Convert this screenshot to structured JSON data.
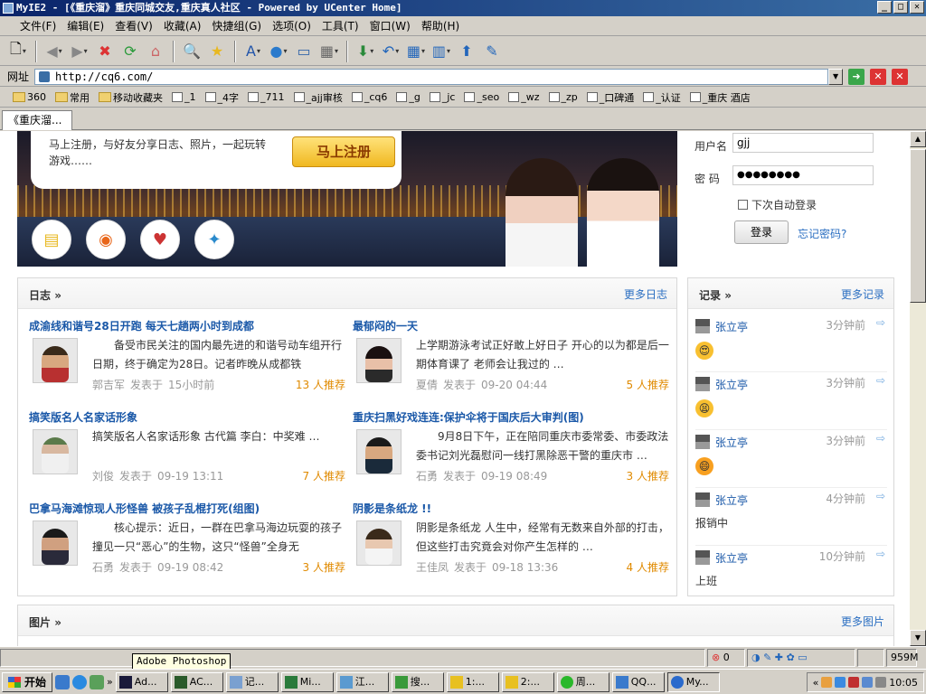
{
  "window": {
    "title": "MyIE2 - [《重庆溜》重庆同城交友,重庆真人社区 - Powered by UCenter Home]",
    "controls": [
      "_",
      "□",
      "✕"
    ]
  },
  "menu": [
    "文件(F)",
    "编辑(E)",
    "查看(V)",
    "收藏(A)",
    "快捷组(G)",
    "选项(O)",
    "工具(T)",
    "窗口(W)",
    "帮助(H)"
  ],
  "address": {
    "label": "网址",
    "value": "http://cq6.com/"
  },
  "favorites": [
    "360",
    "常用",
    "移动收藏夹",
    "_1",
    "_4字",
    "_711",
    "_ajj审核",
    "_cq6",
    "_g",
    "_jc",
    "_seo",
    "_wz",
    "_zp",
    "_口碑通",
    "_认证",
    "_重庆 酒店"
  ],
  "tab": {
    "label": "《重庆溜..."
  },
  "banner": {
    "text": "马上注册，与好友分享日志、照片，一起玩转游戏……",
    "join_label": "马上注册"
  },
  "login": {
    "username_label": "用户名",
    "username_value": "gjj",
    "password_label": "密  码",
    "password_value": "●●●●●●●●",
    "remember_label": "下次自动登录",
    "login_label": "登录",
    "forgot_label": "忘记密码?"
  },
  "blog": {
    "title": "日志",
    "more": "更多日志",
    "posts": [
      {
        "title": "成渝线和谐号28日开跑  每天七趟两小时到成都",
        "excerpt": "备受市民关注的国内最先进的和谐号动车组开行日期，终于确定为28日。记者昨晚从成都铁",
        "author": "郭吉军",
        "action": "发表于",
        "time": "15小时前",
        "rec": "13 人推荐"
      },
      {
        "title": "最郁闷的一天",
        "excerpt": "上学期游泳考试正好敢上好日子 开心的以为都是后一期体育课了 老师会让我过的 …",
        "author": "夏倩",
        "action": "发表于",
        "time": "09-20 04:44",
        "rec": "5 人推荐"
      },
      {
        "title": "搞笑版名人名家话形象",
        "excerpt": "搞笑版名人名家话形象   古代篇 李白：中奖难 …",
        "author": "刘俊",
        "action": "发表于",
        "time": "09-19 13:11",
        "rec": "7 人推荐"
      },
      {
        "title": "重庆扫黑好戏连连:保护伞将于国庆后大审判(图)",
        "excerpt": "9月8日下午，正在陪同重庆市委常委、市委政法委书记刘光磊慰问一线打黑除恶干警的重庆市 …",
        "author": "石勇",
        "action": "发表于",
        "time": "09-19 08:49",
        "rec": "3 人推荐"
      },
      {
        "title": "巴拿马海滩惊现人形怪兽  被孩子乱棍打死(组图)",
        "excerpt": "核心提示：近日，一群在巴拿马海边玩耍的孩子撞见一只“恶心”的生物，这只“怪兽”全身无",
        "author": "石勇",
        "action": "发表于",
        "time": "09-19 08:42",
        "rec": "3 人推荐"
      },
      {
        "title": "阴影是条纸龙  !!",
        "excerpt": "阴影是条纸龙    人生中，经常有无数来自外部的打击，但这些打击究竟会对你产生怎样的 …",
        "author": "王佳凤",
        "action": "发表于",
        "time": "09-18 13:36",
        "rec": "4 人推荐"
      }
    ]
  },
  "records": {
    "title": "记录",
    "more": "更多记录",
    "items": [
      {
        "name": "张立亭",
        "time": "3分钟前",
        "body": "",
        "emoji": "😍"
      },
      {
        "name": "张立亭",
        "time": "3分钟前",
        "body": "",
        "emoji": "😫"
      },
      {
        "name": "张立亭",
        "time": "3分钟前",
        "body": "",
        "emoji": "😄"
      },
      {
        "name": "张立亭",
        "time": "4分钟前",
        "body": "报销中",
        "emoji": ""
      },
      {
        "name": "张立亭",
        "time": "10分钟前",
        "body": "上班",
        "emoji": ""
      }
    ]
  },
  "photos": {
    "title": "图片",
    "more": "更多图片"
  },
  "status": {
    "errors": "0",
    "memory": "959M"
  },
  "tooltip": "Adobe Photoshop",
  "taskbar": {
    "start": "开始",
    "tasks": [
      "Ad...",
      "AC...",
      "记...",
      "Mi...",
      "江...",
      "搜...",
      "1:...",
      "2:...",
      "周...",
      "QQ...",
      "My..."
    ],
    "clock": "10:05"
  },
  "colors": {
    "link": "#1a58a8",
    "accent": "#e08a00",
    "titlebar": "#0a246a"
  }
}
